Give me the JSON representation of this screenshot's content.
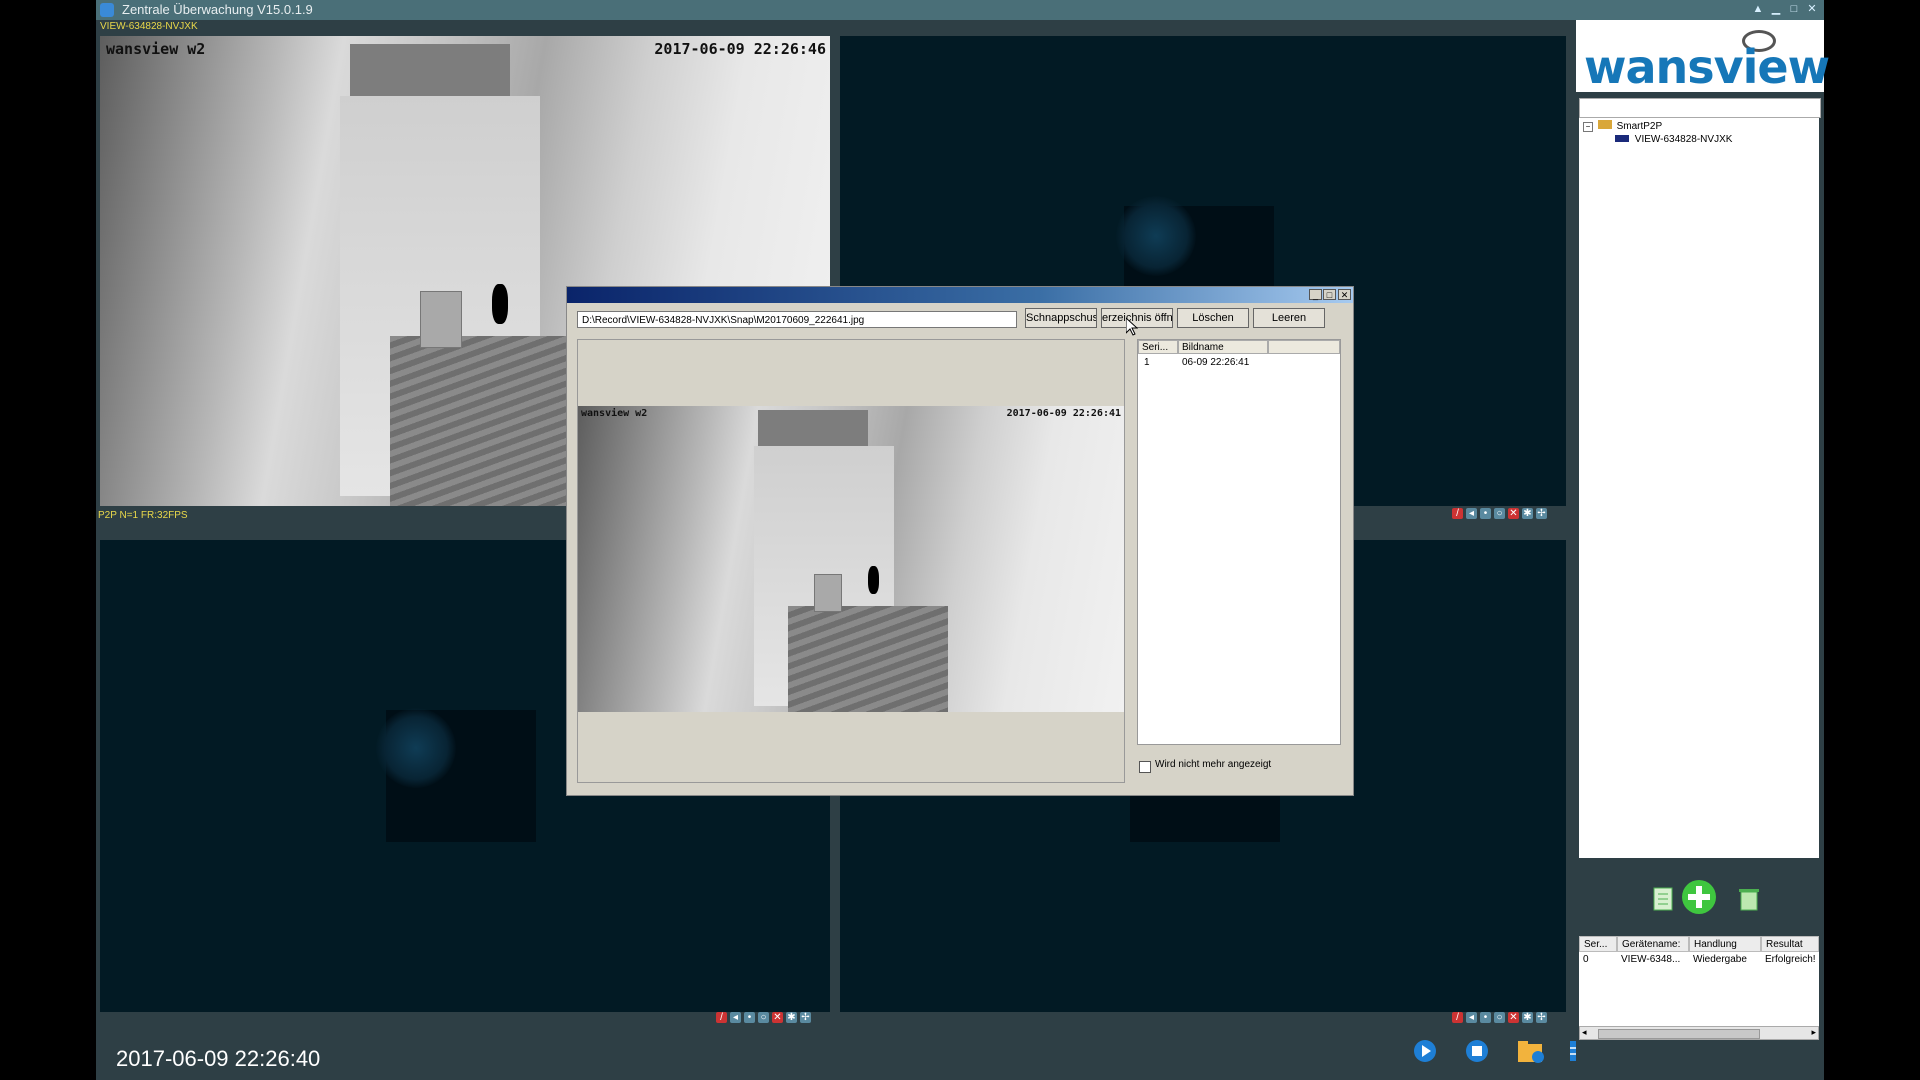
{
  "window": {
    "title": "Zentrale Überwachung V15.0.1.9",
    "camera_label": "VIEW-634828-NVJXK",
    "status_text": "P2P N=1 FR:32FPS"
  },
  "cameras": [
    {
      "osd_name": "wansview w2",
      "osd_time": "2017-06-09 22:26:46"
    }
  ],
  "clock": "2017-06-09 22:26:40",
  "right_panel": {
    "logo_text": "wansview",
    "tree": {
      "root": "SmartP2P",
      "device": "VIEW-634828-NVJXK"
    },
    "table": {
      "headers": [
        "Ser...",
        "Gerätename:",
        "Handlung",
        "Resultat"
      ],
      "rows": [
        [
          "0",
          "VIEW-6348...",
          "Wiedergabe",
          "Erfolgreich!"
        ]
      ]
    }
  },
  "dialog": {
    "path": "D:\\Record\\VIEW-634828-NVJXK\\Snap\\M20170609_222641.jpg",
    "buttons": {
      "snapshot": "Schnappschuss",
      "open_folder": "erzeichnis öffne",
      "delete": "Löschen",
      "clear": "Leeren"
    },
    "preview": {
      "osd_name": "wansview w2",
      "osd_time": "2017-06-09 22:26:41"
    },
    "list": {
      "headers": [
        "Seri...",
        "Bildname"
      ],
      "rows": [
        [
          "1",
          "06-09 22:26:41"
        ]
      ]
    },
    "checkbox_label": "Wird nicht mehr angezeigt"
  },
  "icons": [
    "app-icon",
    "play-icon",
    "stop-icon",
    "folder-video-icon",
    "grid-icon",
    "folder-image-icon",
    "monitor-icon",
    "settings-tools-icon",
    "add-icon",
    "list-icon",
    "delete-icon"
  ],
  "colors": {
    "accent": "#1677b8",
    "status": "#e9d84a",
    "background": "#2e3f45"
  }
}
